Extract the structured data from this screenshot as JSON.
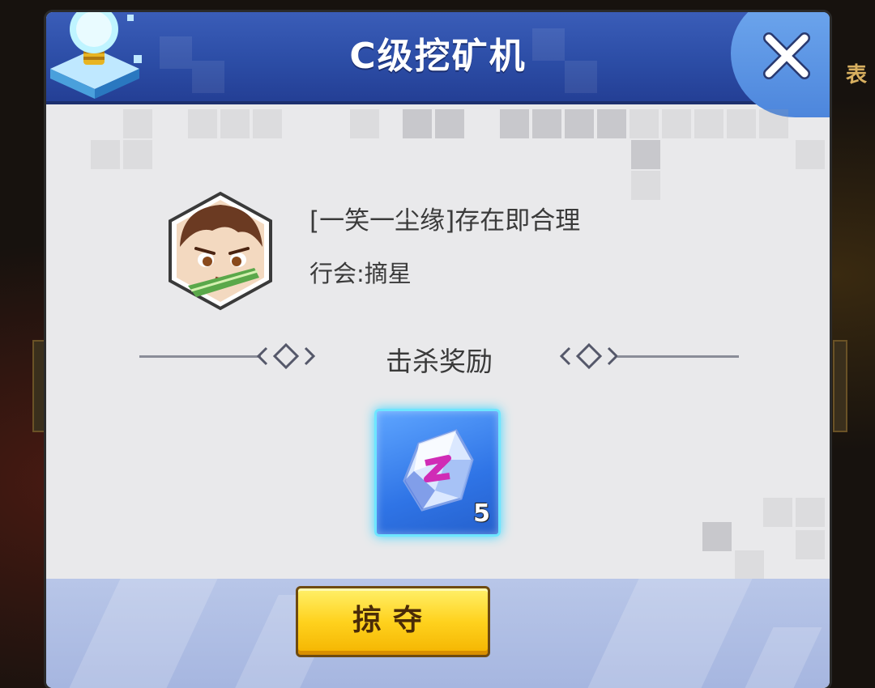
{
  "dialog": {
    "title": "C级挖矿机",
    "close_icon": "close-icon",
    "decor_icon": "lightbulb-icon"
  },
  "player": {
    "name": "[一笑一尘缘]存在即合理",
    "guild": "行会:摘星",
    "avatar": "avatar-icon"
  },
  "reward": {
    "title": "击杀奖励",
    "item": {
      "icon": "blue-crystal-icon",
      "count": "5"
    }
  },
  "action": {
    "label": "掠夺"
  },
  "background": {
    "partial_text": "表"
  },
  "colors": {
    "header": "#2c4da6",
    "panel": "#e9e9eb",
    "button": "#ffd21e",
    "slot": "#2f74e6"
  }
}
